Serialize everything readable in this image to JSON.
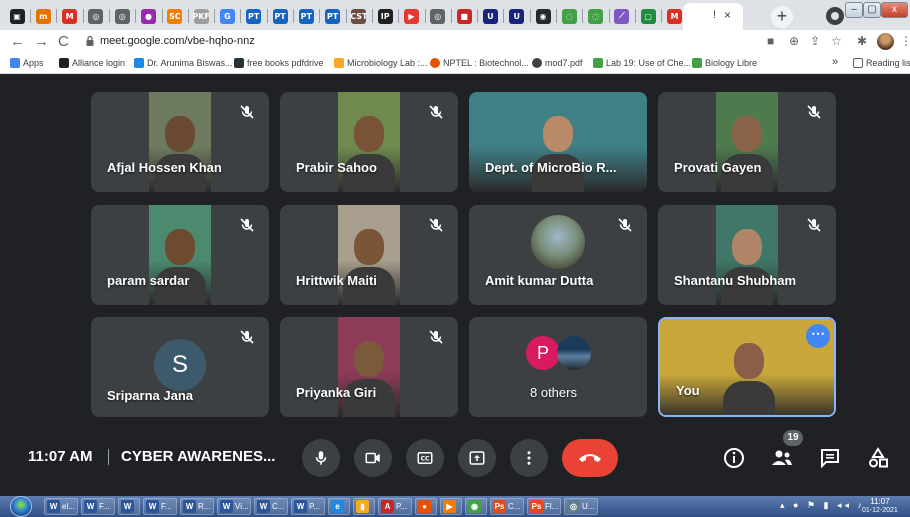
{
  "browser": {
    "tabs": [
      {
        "icon": "display-icon",
        "label": "▣",
        "color": "#202124"
      },
      {
        "icon": "news-icon",
        "label": "m",
        "color": "#e37400"
      },
      {
        "icon": "gmail-icon",
        "label": "M",
        "color": "#d93025"
      },
      {
        "icon": "globe-icon",
        "label": "◎",
        "color": "#5f6368"
      },
      {
        "icon": "globe-icon",
        "label": "◎",
        "color": "#5f6368"
      },
      {
        "icon": "blob-icon",
        "label": "●",
        "color": "#9c27b0"
      },
      {
        "icon": "sc-icon",
        "label": "SC",
        "color": "#f57c00"
      },
      {
        "icon": "pdf-icon",
        "label": "PKF",
        "color": "#9e9e9e"
      },
      {
        "icon": "google-icon",
        "label": "G",
        "color": "#4285f4"
      },
      {
        "icon": "pt-icon",
        "label": "PT",
        "color": "#1565c0"
      },
      {
        "icon": "pt-icon",
        "label": "PT",
        "color": "#1565c0"
      },
      {
        "icon": "pt-icon",
        "label": "PT",
        "color": "#1565c0"
      },
      {
        "icon": "pt-icon",
        "label": "PT",
        "color": "#1565c0"
      },
      {
        "icon": "cst-icon",
        "label": "CST",
        "color": "#6d4c41"
      },
      {
        "icon": "ip-icon",
        "label": "IP",
        "color": "#212121"
      },
      {
        "icon": "youtube-icon",
        "label": "▶",
        "color": "#e53935"
      },
      {
        "icon": "globe-icon",
        "label": "◎",
        "color": "#5f6368"
      },
      {
        "icon": "book-icon",
        "label": "■",
        "color": "#c62828"
      },
      {
        "icon": "u-icon",
        "label": "U",
        "color": "#1a237e"
      },
      {
        "icon": "u-icon",
        "label": "U",
        "color": "#1a237e"
      },
      {
        "icon": "github-icon",
        "label": "◉",
        "color": "#24292e"
      },
      {
        "icon": "sync-icon",
        "label": "◌",
        "color": "#43a047"
      },
      {
        "icon": "sync-icon",
        "label": "◌",
        "color": "#43a047"
      },
      {
        "icon": "feather-icon",
        "label": "⟋",
        "color": "#7e57c2"
      },
      {
        "icon": "meet-icon",
        "label": "▢",
        "color": "#1e8e3e"
      },
      {
        "icon": "gmail-icon",
        "label": "M",
        "color": "#d93025"
      }
    ],
    "active_tab_label": "!",
    "close_label": "×",
    "new_tab_label": "+",
    "url": "meet.google.com/vbe-hqho-nnz",
    "bookmarks": [
      {
        "label": "Apps",
        "color": "#4285f4"
      },
      {
        "label": "Alliance login",
        "color": "#212121"
      },
      {
        "label": "Dr. Arunima Biswas...",
        "color": "#1e88e5"
      },
      {
        "label": "free books pdfdrive",
        "color": "#263238"
      },
      {
        "label": "Microbiology Lab :...",
        "color": "#f9a825"
      },
      {
        "label": "NPTEL : Biotechnol...",
        "color": "#e65100"
      },
      {
        "label": "mod7.pdf",
        "color": "#424242"
      },
      {
        "label": "Lab 19: Use of Che...",
        "color": "#43a047"
      },
      {
        "label": "Biology Libre",
        "color": "#43a047"
      }
    ],
    "bookmarks_more": "»",
    "reading_list": "Reading list"
  },
  "meet": {
    "participants": [
      {
        "name": "Afjal Hossen Khan",
        "muted": true,
        "bg": "#6d7a5f",
        "skin": "#6b4a34"
      },
      {
        "name": "Prabir Sahoo",
        "muted": true,
        "bg": "#6f8a4e",
        "skin": "#7a5236"
      },
      {
        "name": "Dept. of MicroBio R...",
        "muted": false,
        "bg": "#3f7f86",
        "skin": "#b98a68"
      },
      {
        "name": "Provati Gayen",
        "muted": true,
        "bg": "#4f7a4e",
        "skin": "#8a6248"
      },
      {
        "name": "param sardar",
        "muted": true,
        "bg": "#4c8a6f",
        "skin": "#6e4a30"
      },
      {
        "name": "Hrittwik Maiti",
        "muted": true,
        "bg": "#a89f8e",
        "skin": "#7a5538"
      },
      {
        "name": "Amit kumar Dutta",
        "muted": true,
        "bg": "#3c4043",
        "skin": "#8a7060"
      },
      {
        "name": "Shantanu Shubham",
        "muted": true,
        "bg": "#3f7868",
        "skin": "#b08466"
      },
      {
        "name": "Sriparna Jana",
        "muted": true,
        "initial": "S",
        "bg": "#3c4043"
      },
      {
        "name": "Priyanka Giri",
        "muted": true,
        "bg": "#8e3b5a",
        "skin": "#7a5a3a"
      },
      {
        "name": "8 others",
        "muted": false,
        "initial": "P",
        "bg": "#3c4043"
      },
      {
        "name": "You",
        "muted": false,
        "bg": "#c9a73a",
        "skin": "#8a5e48"
      }
    ],
    "time": "11:07 AM",
    "meeting_title": "CYBER AWARENES...",
    "participant_count": "19",
    "more_options_label": "⋯"
  },
  "taskbar": {
    "apps": [
      {
        "label": "el...",
        "icon": "W",
        "color": "#2b579a"
      },
      {
        "label": "F...",
        "icon": "W",
        "color": "#2b579a"
      },
      {
        "label": "",
        "icon": "W",
        "color": "#2b579a"
      },
      {
        "label": "F...",
        "icon": "W",
        "color": "#2b579a"
      },
      {
        "label": "R...",
        "icon": "W",
        "color": "#2b579a"
      },
      {
        "label": "Vi...",
        "icon": "W",
        "color": "#2b579a"
      },
      {
        "label": "C...",
        "icon": "W",
        "color": "#2b579a"
      },
      {
        "label": "P...",
        "icon": "W",
        "color": "#2b579a"
      },
      {
        "label": "",
        "icon": "e",
        "color": "#1e88e5"
      },
      {
        "label": "",
        "icon": "▮",
        "color": "#f9a825"
      },
      {
        "label": "P...",
        "icon": "A",
        "color": "#c62828"
      },
      {
        "label": "",
        "icon": "●",
        "color": "#e65100"
      },
      {
        "label": "",
        "icon": "▶",
        "color": "#f57c00"
      },
      {
        "label": "",
        "icon": "◉",
        "color": "#43a047"
      },
      {
        "label": "C...",
        "icon": "Ps",
        "color": "#e64a19"
      },
      {
        "label": "Fl...",
        "icon": "Ps",
        "color": "#e64a19"
      },
      {
        "label": "U...",
        "icon": "◎",
        "color": "#607d8b"
      }
    ],
    "clock_time": "11:07",
    "clock_date": "01-12-2021"
  }
}
